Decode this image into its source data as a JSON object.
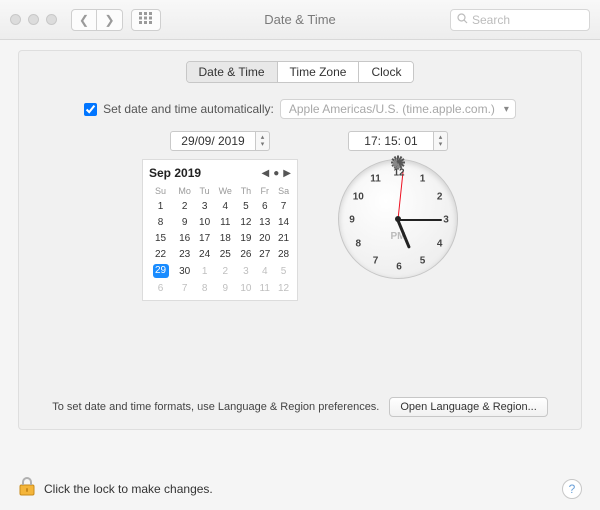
{
  "window": {
    "title": "Date & Time",
    "search_placeholder": "Search"
  },
  "tabs": {
    "items": [
      "Date & Time",
      "Time Zone",
      "Clock"
    ],
    "active_index": 0
  },
  "auto": {
    "checked": true,
    "label": "Set date and time automatically:",
    "server": "Apple Americas/U.S. (time.apple.com.)"
  },
  "date": {
    "value": "29/09/ 2019",
    "month_year": "Sep 2019",
    "weekday_headers": [
      "Su",
      "Mo",
      "Tu",
      "We",
      "Th",
      "Fr",
      "Sa"
    ],
    "weeks": [
      [
        {
          "d": 1
        },
        {
          "d": 2
        },
        {
          "d": 3
        },
        {
          "d": 4
        },
        {
          "d": 5
        },
        {
          "d": 6
        },
        {
          "d": 7
        }
      ],
      [
        {
          "d": 8
        },
        {
          "d": 9
        },
        {
          "d": 10
        },
        {
          "d": 11
        },
        {
          "d": 12
        },
        {
          "d": 13
        },
        {
          "d": 14
        }
      ],
      [
        {
          "d": 15
        },
        {
          "d": 16
        },
        {
          "d": 17
        },
        {
          "d": 18
        },
        {
          "d": 19
        },
        {
          "d": 20
        },
        {
          "d": 21
        }
      ],
      [
        {
          "d": 22
        },
        {
          "d": 23
        },
        {
          "d": 24
        },
        {
          "d": 25
        },
        {
          "d": 26
        },
        {
          "d": 27
        },
        {
          "d": 28
        }
      ],
      [
        {
          "d": 29,
          "sel": true
        },
        {
          "d": 30
        },
        {
          "d": 1,
          "other": true
        },
        {
          "d": 2,
          "other": true
        },
        {
          "d": 3,
          "other": true
        },
        {
          "d": 4,
          "other": true
        },
        {
          "d": 5,
          "other": true
        }
      ],
      [
        {
          "d": 6,
          "other": true
        },
        {
          "d": 7,
          "other": true
        },
        {
          "d": 8,
          "other": true
        },
        {
          "d": 9,
          "other": true
        },
        {
          "d": 10,
          "other": true
        },
        {
          "d": 11,
          "other": true
        },
        {
          "d": 12,
          "other": true
        }
      ]
    ]
  },
  "time": {
    "value": "17: 15: 01",
    "ampm": "PM",
    "hour": 17,
    "minute": 15,
    "second": 1
  },
  "hint": {
    "text": "To set date and time formats, use Language & Region preferences.",
    "button": "Open Language & Region..."
  },
  "footer": {
    "text": "Click the lock to make changes."
  }
}
